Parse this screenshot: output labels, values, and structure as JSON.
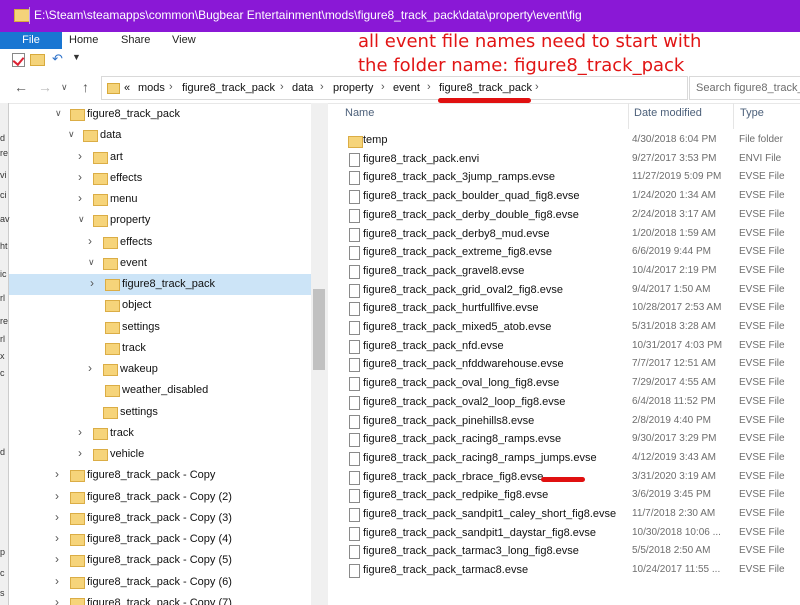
{
  "window": {
    "title": "E:\\Steam\\steamapps\\common\\Bugbear Entertainment\\mods\\figure8_track_pack\\data\\property\\event\\fig"
  },
  "ribbon": {
    "file": "File",
    "tabs": [
      "Home",
      "Share",
      "View"
    ]
  },
  "address": {
    "crumbs": [
      "«",
      "mods",
      "figure8_track_pack",
      "data",
      "property",
      "event",
      "figure8_track_pack"
    ],
    "search_placeholder": "Search figure8_track_pa..."
  },
  "annotation": {
    "line1": "all event file names need to start with",
    "line2": "the folder name: figure8_track_pack",
    "color": "#e11414"
  },
  "left_strip": [
    "d",
    "re",
    "vi",
    "ci",
    "av",
    "ht",
    "ic",
    "rl",
    "re",
    "rl",
    "x",
    "c",
    "d",
    "p",
    "c",
    "s"
  ],
  "tree": [
    {
      "label": "figure8_track_pack",
      "level": 0,
      "expanded": true
    },
    {
      "label": "data",
      "level": 1,
      "expanded": true
    },
    {
      "label": "art",
      "level": 2,
      "expanded": false
    },
    {
      "label": "effects",
      "level": 2,
      "expanded": false
    },
    {
      "label": "menu",
      "level": 2,
      "expanded": false
    },
    {
      "label": "property",
      "level": 2,
      "expanded": true
    },
    {
      "label": "effects",
      "level": 3,
      "expanded": false
    },
    {
      "label": "event",
      "level": 3,
      "expanded": true
    },
    {
      "label": "figure8_track_pack",
      "level": 4,
      "expanded": false,
      "selected": true
    },
    {
      "label": "object",
      "level": 4,
      "expanded": null
    },
    {
      "label": "settings",
      "level": 4,
      "expanded": null
    },
    {
      "label": "track",
      "level": 4,
      "expanded": null
    },
    {
      "label": "wakeup",
      "level": 3,
      "expanded": false
    },
    {
      "label": "weather_disabled",
      "level": 4,
      "expanded": null
    },
    {
      "label": "settings",
      "level": 3,
      "expanded": null
    },
    {
      "label": "track",
      "level": 2,
      "expanded": false
    },
    {
      "label": "vehicle",
      "level": 2,
      "expanded": false
    },
    {
      "label": "figure8_track_pack - Copy",
      "level": 0,
      "expanded": false
    },
    {
      "label": "figure8_track_pack - Copy (2)",
      "level": 0,
      "expanded": false
    },
    {
      "label": "figure8_track_pack - Copy (3)",
      "level": 0,
      "expanded": false
    },
    {
      "label": "figure8_track_pack - Copy (4)",
      "level": 0,
      "expanded": false
    },
    {
      "label": "figure8_track_pack - Copy (5)",
      "level": 0,
      "expanded": false
    },
    {
      "label": "figure8_track_pack - Copy (6)",
      "level": 0,
      "expanded": false
    },
    {
      "label": "figure8_track_pack - Copy (7)",
      "level": 0,
      "expanded": false
    }
  ],
  "columns": {
    "name": "Name",
    "date": "Date modified",
    "type": "Type"
  },
  "files": [
    {
      "name": "temp",
      "date": "4/30/2018 6:04 PM",
      "type": "File folder",
      "kind": "folder"
    },
    {
      "name": "figure8_track_pack.envi",
      "date": "9/27/2017 3:53 PM",
      "type": "ENVI File",
      "kind": "file"
    },
    {
      "name": "figure8_track_pack_3jump_ramps.evse",
      "date": "11/27/2019 5:09 PM",
      "type": "EVSE File",
      "kind": "file"
    },
    {
      "name": "figure8_track_pack_boulder_quad_fig8.evse",
      "date": "1/24/2020 1:34 AM",
      "type": "EVSE File",
      "kind": "file"
    },
    {
      "name": "figure8_track_pack_derby_double_fig8.evse",
      "date": "2/24/2018 3:17 AM",
      "type": "EVSE File",
      "kind": "file"
    },
    {
      "name": "figure8_track_pack_derby8_mud.evse",
      "date": "1/20/2018 1:59 AM",
      "type": "EVSE File",
      "kind": "file"
    },
    {
      "name": "figure8_track_pack_extreme_fig8.evse",
      "date": "6/6/2019 9:44 PM",
      "type": "EVSE File",
      "kind": "file"
    },
    {
      "name": "figure8_track_pack_gravel8.evse",
      "date": "10/4/2017 2:19 PM",
      "type": "EVSE File",
      "kind": "file"
    },
    {
      "name": "figure8_track_pack_grid_oval2_fig8.evse",
      "date": "9/4/2017 1:50 AM",
      "type": "EVSE File",
      "kind": "file"
    },
    {
      "name": "figure8_track_pack_hurtfullfive.evse",
      "date": "10/28/2017 2:53 AM",
      "type": "EVSE File",
      "kind": "file"
    },
    {
      "name": "figure8_track_pack_mixed5_atob.evse",
      "date": "5/31/2018 3:28 AM",
      "type": "EVSE File",
      "kind": "file"
    },
    {
      "name": "figure8_track_pack_nfd.evse",
      "date": "10/31/2017 4:03 PM",
      "type": "EVSE File",
      "kind": "file"
    },
    {
      "name": "figure8_track_pack_nfddwarehouse.evse",
      "date": "7/7/2017 12:51 AM",
      "type": "EVSE File",
      "kind": "file"
    },
    {
      "name": "figure8_track_pack_oval_long_fig8.evse",
      "date": "7/29/2017 4:55 AM",
      "type": "EVSE File",
      "kind": "file"
    },
    {
      "name": "figure8_track_pack_oval2_loop_fig8.evse",
      "date": "6/4/2018 11:52 PM",
      "type": "EVSE File",
      "kind": "file"
    },
    {
      "name": "figure8_track_pack_pinehills8.evse",
      "date": "2/8/2019 4:40 PM",
      "type": "EVSE File",
      "kind": "file"
    },
    {
      "name": "figure8_track_pack_racing8_ramps.evse",
      "date": "9/30/2017 3:29 PM",
      "type": "EVSE File",
      "kind": "file"
    },
    {
      "name": "figure8_track_pack_racing8_ramps_jumps.evse",
      "date": "4/12/2019 3:43 AM",
      "type": "EVSE File",
      "kind": "file"
    },
    {
      "name": "figure8_track_pack_rbrace_fig8.evse",
      "date": "3/31/2020 3:19 AM",
      "type": "EVSE File",
      "kind": "file"
    },
    {
      "name": "figure8_track_pack_redpike_fig8.evse",
      "date": "3/6/2019 3:45 PM",
      "type": "EVSE File",
      "kind": "file"
    },
    {
      "name": "figure8_track_pack_sandpit1_caley_short_fig8.evse",
      "date": "11/7/2018 2:30 AM",
      "type": "EVSE File",
      "kind": "file"
    },
    {
      "name": "figure8_track_pack_sandpit1_daystar_fig8.evse",
      "date": "10/30/2018 10:06 ...",
      "type": "EVSE File",
      "kind": "file"
    },
    {
      "name": "figure8_track_pack_tarmac3_long_fig8.evse",
      "date": "5/5/2018 2:50 AM",
      "type": "EVSE File",
      "kind": "file"
    },
    {
      "name": "figure8_track_pack_tarmac8.evse",
      "date": "10/24/2017 11:55 ...",
      "type": "EVSE File",
      "kind": "file"
    }
  ]
}
